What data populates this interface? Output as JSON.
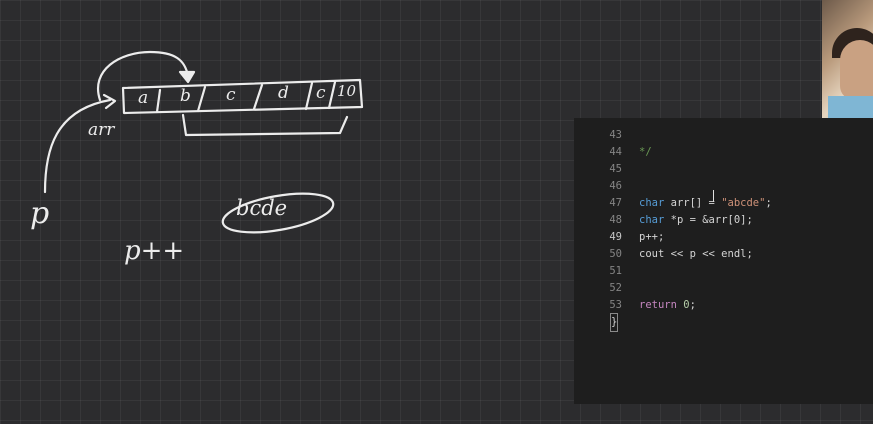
{
  "whiteboard": {
    "array_cells": [
      "a",
      "b",
      "c",
      "d",
      "c",
      "10"
    ],
    "arr_label": "arr",
    "pointer_label": "p",
    "increment_label": "p++",
    "output_label": "bcde"
  },
  "editor": {
    "lines": [
      {
        "num": "43",
        "text": "*/",
        "kind": "comment"
      },
      {
        "num": "44",
        "text": ""
      },
      {
        "num": "45",
        "text": ""
      },
      {
        "num": "46",
        "kw": "char",
        "rest": " arr[] = ",
        "str": "\"abcde\"",
        "tail": ";"
      },
      {
        "num": "47",
        "kw": "char",
        "rest": " *p = &arr[0];"
      },
      {
        "num": "48",
        "rest": "p++;"
      },
      {
        "num": "49",
        "rest": "cout << p << endl;"
      },
      {
        "num": "50",
        "text": ""
      },
      {
        "num": "51",
        "text": ""
      },
      {
        "num": "52",
        "kw": "return",
        "rest": " ",
        "numlit": "0",
        "tail": ";"
      },
      {
        "num": "53",
        "text": "}"
      }
    ],
    "active_line": "49"
  },
  "colors": {
    "board_bg": "#2c2c2e",
    "ink": "#ececec",
    "editor_bg": "#1e1e1e",
    "keyword": "#569cd6",
    "string": "#ce9178",
    "number": "#b5cea8"
  }
}
